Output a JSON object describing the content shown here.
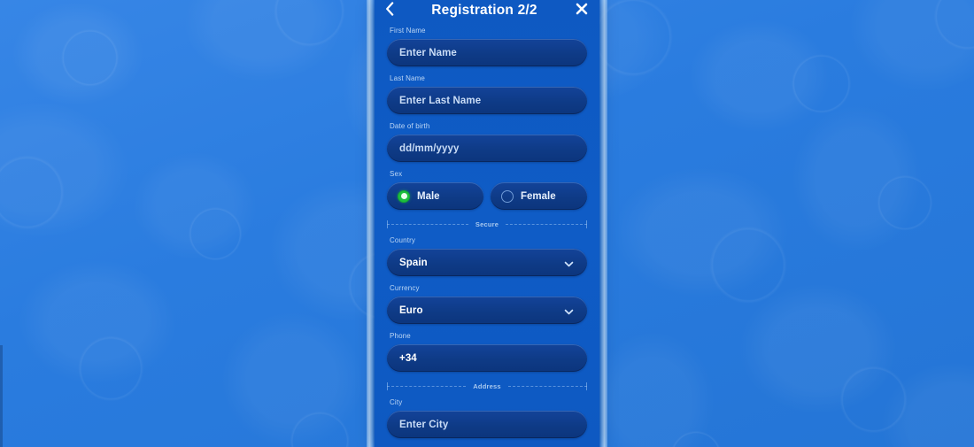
{
  "header": {
    "title": "Registration 2/2",
    "back_icon": "chevron-left-icon",
    "close_icon": "close-x-icon"
  },
  "form": {
    "fields": [
      {
        "label": "First Name",
        "placeholder": "Enter Name",
        "value": "",
        "type": "text"
      },
      {
        "label": "Last Name",
        "placeholder": "Enter Last Name",
        "value": "",
        "type": "text"
      },
      {
        "label": "Date of birth",
        "placeholder": "dd/mm/yyyy",
        "value": "",
        "type": "text"
      }
    ],
    "sex": {
      "label": "Sex",
      "options": [
        {
          "label": "Male",
          "selected": true
        },
        {
          "label": "Female",
          "selected": false
        }
      ]
    },
    "dividers": {
      "secure": "Secure",
      "address": "Address"
    },
    "selects": [
      {
        "label": "Country",
        "value": "Spain",
        "icon": "chevron-down-icon"
      },
      {
        "label": "Currency",
        "value": "Euro",
        "icon": "chevron-down-icon"
      }
    ],
    "phone": {
      "label": "Phone",
      "value": "+34",
      "placeholder": ""
    },
    "city": {
      "label": "City",
      "placeholder": "Enter City",
      "value": ""
    }
  },
  "colors": {
    "wallpaper": "#2a7cdf",
    "panel": "#0f5bc4",
    "input": "#0f3c88",
    "accent_green": "#1dbf3e",
    "label_text": "#bcd6f4",
    "placeholder_text": "#c9dcf6",
    "value_text": "#ffffff"
  }
}
